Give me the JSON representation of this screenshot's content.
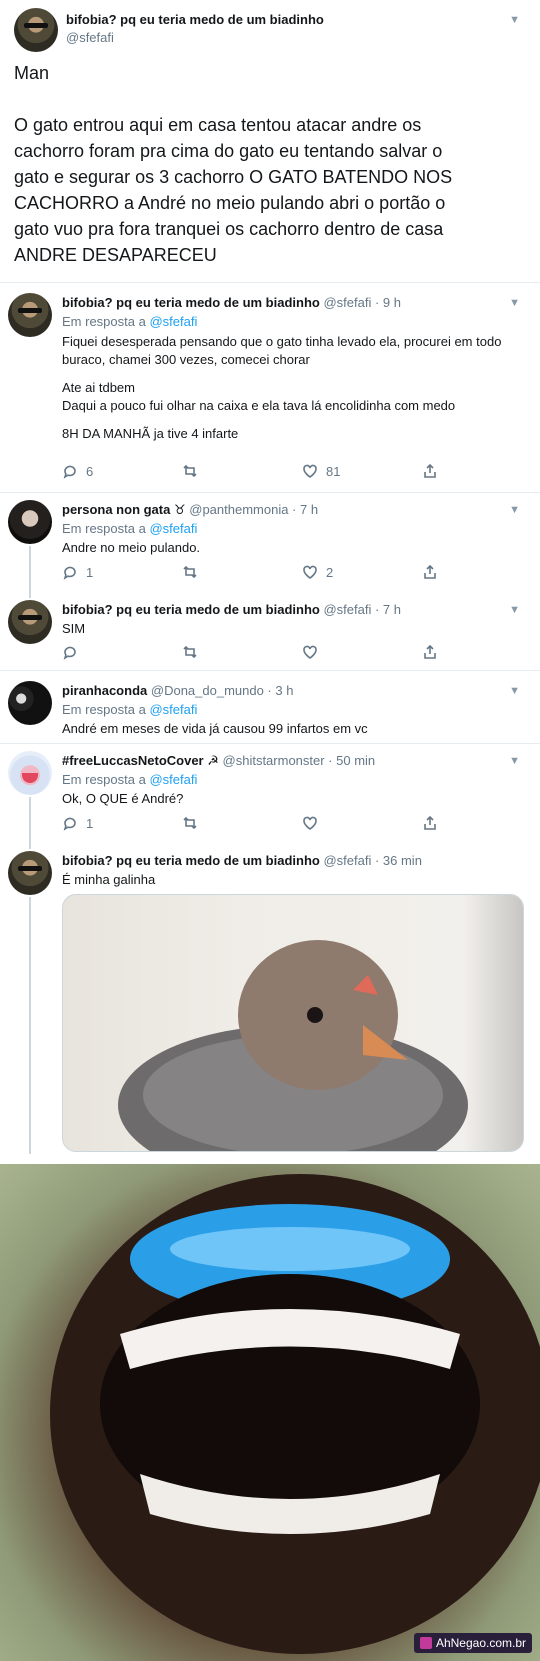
{
  "main_tweet": {
    "name": "bifobia? pq eu teria medo de um biadinho",
    "handle": "@sfefafi",
    "text_lines": [
      "Man",
      "",
      "O gato entrou aqui em casa tentou atacar andre os",
      "cachorro foram pra cima do gato eu tentando salvar o",
      "gato e segurar os 3 cachorro O GATO BATENDO NOS",
      "CACHORRO a André no meio pulando abri o portão o",
      "gato vuo pra fora tranquei os cachorro dentro de casa",
      "ANDRE DESAPARECEU"
    ]
  },
  "replies": [
    {
      "name": "bifobia? pq eu teria medo de um biadinho",
      "meta": "@sfefafi · 9 h",
      "in_reply_label": "Em resposta a",
      "in_reply_to": "@sfefafi",
      "lines": [
        "Fiquei desesperada pensando que o gato tinha levado ela, procurei em todo",
        "buraco, chamei 300 vezes, comecei chorar",
        "",
        "Ate ai tdbem",
        "Daqui a pouco fui olhar na caixa e ela tava lá encolidinha com medo",
        "",
        "8H DA MANHÃ ja tive 4 infarte"
      ],
      "replies_count": "6",
      "retweets_count": "",
      "likes_count": "81"
    },
    {
      "name": "persona non gata ♉",
      "meta": "@panthemmonia · 7 h",
      "in_reply_label": "Em resposta a",
      "in_reply_to": "@sfefafi",
      "lines": [
        "Andre no meio pulando."
      ],
      "replies_count": "1",
      "retweets_count": "",
      "likes_count": "2"
    },
    {
      "name": "bifobia? pq eu teria medo de um biadinho",
      "meta": "@sfefafi · 7 h",
      "lines": [
        "SIM"
      ],
      "replies_count": "",
      "retweets_count": "",
      "likes_count": ""
    },
    {
      "name": "piranhaconda",
      "meta": "@Dona_do_mundo · 3 h",
      "in_reply_label": "Em resposta a",
      "in_reply_to": "@sfefafi",
      "lines": [
        "André em meses de vida já causou 99 infartos em vc"
      ]
    },
    {
      "name": "#freeLuccasNetoCover ☭",
      "meta": "@shitstarmonster · 50 min",
      "in_reply_label": "Em resposta a",
      "in_reply_to": "@sfefafi",
      "lines": [
        "Ok, O QUE é André?"
      ],
      "replies_count": "1",
      "retweets_count": "",
      "likes_count": ""
    },
    {
      "name": "bifobia? pq eu teria medo de um biadinho",
      "meta": "@sfefafi · 36 min",
      "lines": [
        "É minha galinha"
      ]
    }
  ],
  "watermark": "AhNegao.com.br"
}
